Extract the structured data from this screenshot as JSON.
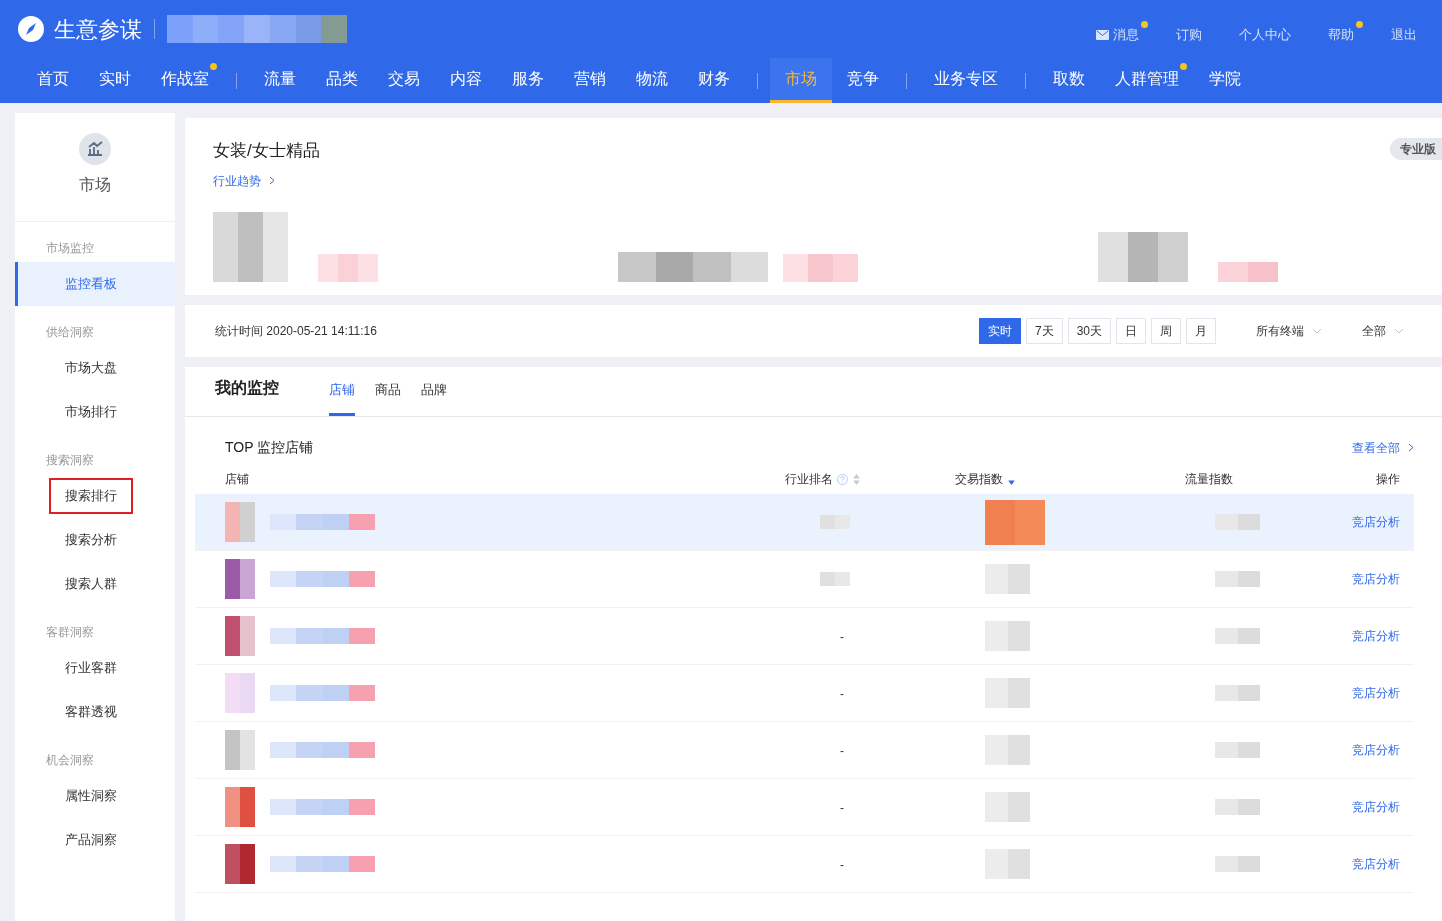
{
  "header": {
    "brand": "生意参谋",
    "top_links": [
      {
        "label": "消息",
        "kind": "mail",
        "dot": true
      },
      {
        "label": "订购",
        "dot": false
      },
      {
        "label": "个人中心",
        "dot": false
      },
      {
        "label": "帮助",
        "dot": true
      },
      {
        "label": "退出",
        "dot": false
      }
    ],
    "nav_groups": [
      [
        {
          "label": "首页",
          "selected": false,
          "dot": false
        },
        {
          "label": "实时",
          "selected": false,
          "dot": false
        },
        {
          "label": "作战室",
          "selected": false,
          "dot": true
        }
      ],
      [
        {
          "label": "流量",
          "selected": false,
          "dot": false
        },
        {
          "label": "品类",
          "selected": false,
          "dot": false
        },
        {
          "label": "交易",
          "selected": false,
          "dot": false
        },
        {
          "label": "内容",
          "selected": false,
          "dot": false
        },
        {
          "label": "服务",
          "selected": false,
          "dot": false
        },
        {
          "label": "营销",
          "selected": false,
          "dot": false
        },
        {
          "label": "物流",
          "selected": false,
          "dot": false
        },
        {
          "label": "财务",
          "selected": false,
          "dot": false
        }
      ],
      [
        {
          "label": "市场",
          "selected": true,
          "dot": false
        },
        {
          "label": "竞争",
          "selected": false,
          "dot": false
        }
      ],
      [
        {
          "label": "业务专区",
          "selected": false,
          "dot": false
        }
      ],
      [
        {
          "label": "取数",
          "selected": false,
          "dot": false
        },
        {
          "label": "人群管理",
          "selected": false,
          "dot": true
        },
        {
          "label": "学院",
          "selected": false,
          "dot": false
        }
      ]
    ]
  },
  "sidebar": {
    "title": "市场",
    "sections": [
      {
        "heading": "市场监控",
        "items": [
          {
            "label": "监控看板",
            "selected": true,
            "outlined": false
          }
        ]
      },
      {
        "heading": "供给洞察",
        "items": [
          {
            "label": "市场大盘",
            "selected": false,
            "outlined": false
          },
          {
            "label": "市场排行",
            "selected": false,
            "outlined": false
          }
        ]
      },
      {
        "heading": "搜索洞察",
        "items": [
          {
            "label": "搜索排行",
            "selected": false,
            "outlined": true
          },
          {
            "label": "搜索分析",
            "selected": false,
            "outlined": false
          },
          {
            "label": "搜索人群",
            "selected": false,
            "outlined": false
          }
        ]
      },
      {
        "heading": "客群洞察",
        "items": [
          {
            "label": "行业客群",
            "selected": false,
            "outlined": false
          },
          {
            "label": "客群透视",
            "selected": false,
            "outlined": false
          }
        ]
      },
      {
        "heading": "机会洞察",
        "items": [
          {
            "label": "属性洞察",
            "selected": false,
            "outlined": false
          },
          {
            "label": "产品洞察",
            "selected": false,
            "outlined": false
          }
        ]
      }
    ]
  },
  "category_card": {
    "title": "女装/女士精品",
    "link": "行业趋势",
    "badge": "专业版"
  },
  "filter_bar": {
    "stat_time": "统计时间 2020-05-21 14:11:16",
    "periods": [
      {
        "label": "实时",
        "selected": true
      },
      {
        "label": "7天",
        "selected": false
      },
      {
        "label": "30天",
        "selected": false
      },
      {
        "label": "日",
        "selected": false
      },
      {
        "label": "周",
        "selected": false
      },
      {
        "label": "月",
        "selected": false
      }
    ],
    "dropdowns": [
      "所有终端",
      "全部"
    ]
  },
  "monitor": {
    "title": "我的监控",
    "tabs": [
      {
        "label": "店铺",
        "selected": true
      },
      {
        "label": "商品",
        "selected": false
      },
      {
        "label": "品牌",
        "selected": false
      }
    ],
    "subtitle": "TOP 监控店铺",
    "view_all": "查看全部",
    "columns": [
      {
        "label": "店铺",
        "help": false,
        "sortable": false
      },
      {
        "label": "行业排名",
        "help": true,
        "sortable": true,
        "sorted_desc": false
      },
      {
        "label": "交易指数",
        "help": false,
        "sortable": true,
        "sorted_desc": true
      },
      {
        "label": "流量指数",
        "help": false,
        "sortable": false
      },
      {
        "label": "操作",
        "help": false,
        "sortable": false
      }
    ],
    "rows": [
      {
        "highlighted": true,
        "action": "竞店分析"
      },
      {
        "highlighted": false,
        "action": "竞店分析"
      },
      {
        "highlighted": false,
        "rank": "-",
        "action": "竞店分析"
      },
      {
        "highlighted": false,
        "rank": "-",
        "action": "竞店分析"
      },
      {
        "highlighted": false,
        "rank": "-",
        "action": "竞店分析"
      },
      {
        "highlighted": false,
        "rank": "-",
        "action": "竞店分析"
      },
      {
        "highlighted": false,
        "rank": "-",
        "action": "竞店分析"
      }
    ]
  }
}
